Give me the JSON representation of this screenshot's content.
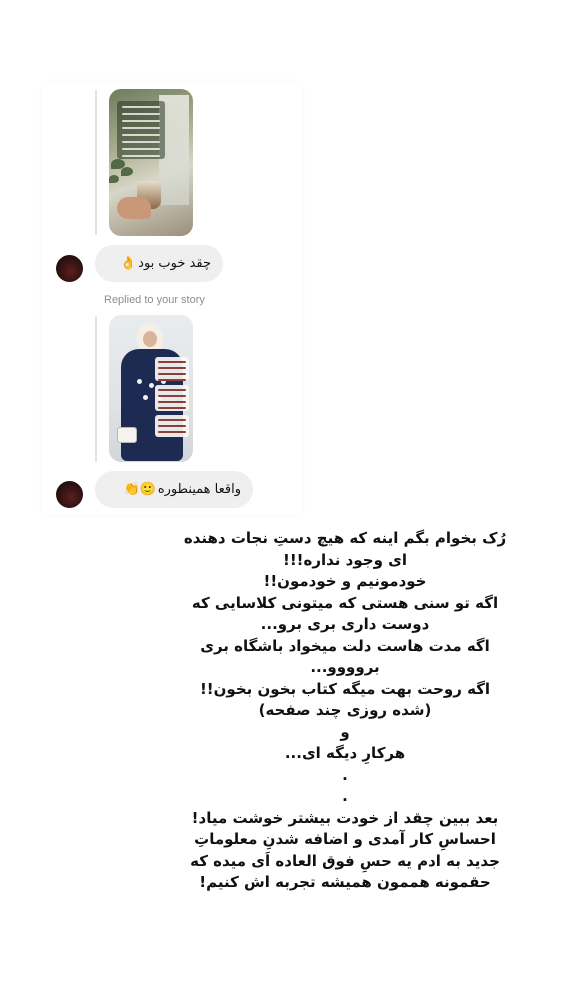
{
  "dm_thread": {
    "story_reply_1": {
      "message": "چقد خوب بود",
      "emoji": "👌"
    },
    "replied_label": "Replied to your story",
    "story_reply_2": {
      "message": "واقعا همینطوره",
      "emoji": "🙂👏"
    }
  },
  "caption_lines": [
    "رُک بخوام بگم اینه که هیچ دستِ نجات دهنده",
    "ای وجود نداره!!!",
    "خودمونیم و خودمون!!",
    "اگه تو سنی هستی که میتونی کلاسایی که",
    "دوست داری بری برو...",
    "اگه مدت هاست دلت میخواد باشگاه بری",
    "بروووو...",
    "اگه روحت بهت میگه کتاب بخون بخون!!",
    "(شده روزی چند صفحه)",
    "و",
    "هرکارِ دیگه ای...",
    ".",
    ".",
    "بعد ببین چقد از خودت بیشتر خوشت میاد!",
    "احساسِ کار آمدی و اضافه شدنِ معلوماتِ",
    "جدید به ادم یه حسِ فوق العاده اَی میده که",
    "حقمونه هممون همیشه تجربه اش کنیم!"
  ]
}
